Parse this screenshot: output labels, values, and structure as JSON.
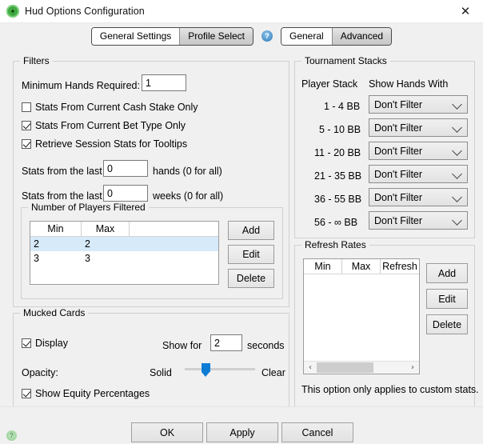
{
  "window": {
    "title": "Hud Options Configuration",
    "app_icon": "poker-chip-icon",
    "close_label": "✕"
  },
  "tabstrip": {
    "left_group": [
      {
        "label": "General Settings",
        "active": false
      },
      {
        "label": "Profile Select",
        "active": true
      }
    ],
    "help_icon": "help-circle-icon",
    "right_group": [
      {
        "label": "General",
        "active": false
      },
      {
        "label": "Advanced",
        "active": true
      }
    ]
  },
  "filters": {
    "title": "Filters",
    "min_hands_label": "Minimum Hands Required:",
    "min_hands_value": "1",
    "checkboxes": [
      {
        "label": "Stats From Current Cash Stake Only",
        "checked": false
      },
      {
        "label": "Stats From Current Bet Type Only",
        "checked": true
      },
      {
        "label": "Retrieve Session Stats for Tooltips",
        "checked": true
      }
    ],
    "hands_label": "Stats from the last",
    "hands_value": "0",
    "hands_suffix": "hands (0 for all)",
    "weeks_label": "Stats from the last",
    "weeks_value": "0",
    "weeks_suffix": "weeks (0 for all)"
  },
  "players_filtered": {
    "title": "Number of Players Filtered",
    "columns": [
      "Min",
      "Max",
      ""
    ],
    "rows": [
      {
        "min": "2",
        "max": "2",
        "selected": true
      },
      {
        "min": "3",
        "max": "3",
        "selected": false
      }
    ],
    "buttons": [
      "Add",
      "Edit",
      "Delete"
    ]
  },
  "mucked_cards": {
    "title": "Mucked Cards",
    "display_label": "Display",
    "display_checked": true,
    "show_for_label": "Show for",
    "show_for_value": "2",
    "seconds_label": "seconds",
    "opacity_label": "Opacity:",
    "slider_min_label": "Solid",
    "slider_max_label": "Clear",
    "slider_percent": 24,
    "equity_label": "Show Equity Percentages",
    "equity_checked": true
  },
  "tournament_stacks": {
    "title": "Tournament Stacks",
    "col_stack": "Player Stack",
    "col_filter": "Show Hands With",
    "rows": [
      {
        "stack": "1 - 4 BB",
        "filter": "Don't Filter"
      },
      {
        "stack": "5 - 10 BB",
        "filter": "Don't Filter"
      },
      {
        "stack": "11 - 20 BB",
        "filter": "Don't Filter"
      },
      {
        "stack": "21 - 35 BB",
        "filter": "Don't Filter"
      },
      {
        "stack": "36 - 55 BB",
        "filter": "Don't Filter"
      },
      {
        "stack": "56 - ∞ BB",
        "filter": "Don't Filter"
      }
    ]
  },
  "refresh_rates": {
    "title": "Refresh Rates",
    "columns": [
      "Min",
      "Max",
      "Refresh"
    ],
    "rows": [],
    "buttons": [
      "Add",
      "Edit",
      "Delete"
    ],
    "note": "This option only applies to custom stats.",
    "scroll_left": "‹",
    "scroll_right": "›"
  },
  "bottom": {
    "status_icon": "help-circle-icon",
    "buttons": [
      "OK",
      "Apply",
      "Cancel"
    ]
  },
  "colors": {
    "accent_blue": "#0c7cd5",
    "selection_blue": "#d7eafa",
    "window_bg": "#f0f0f0",
    "chip_green": "#3da03d"
  }
}
